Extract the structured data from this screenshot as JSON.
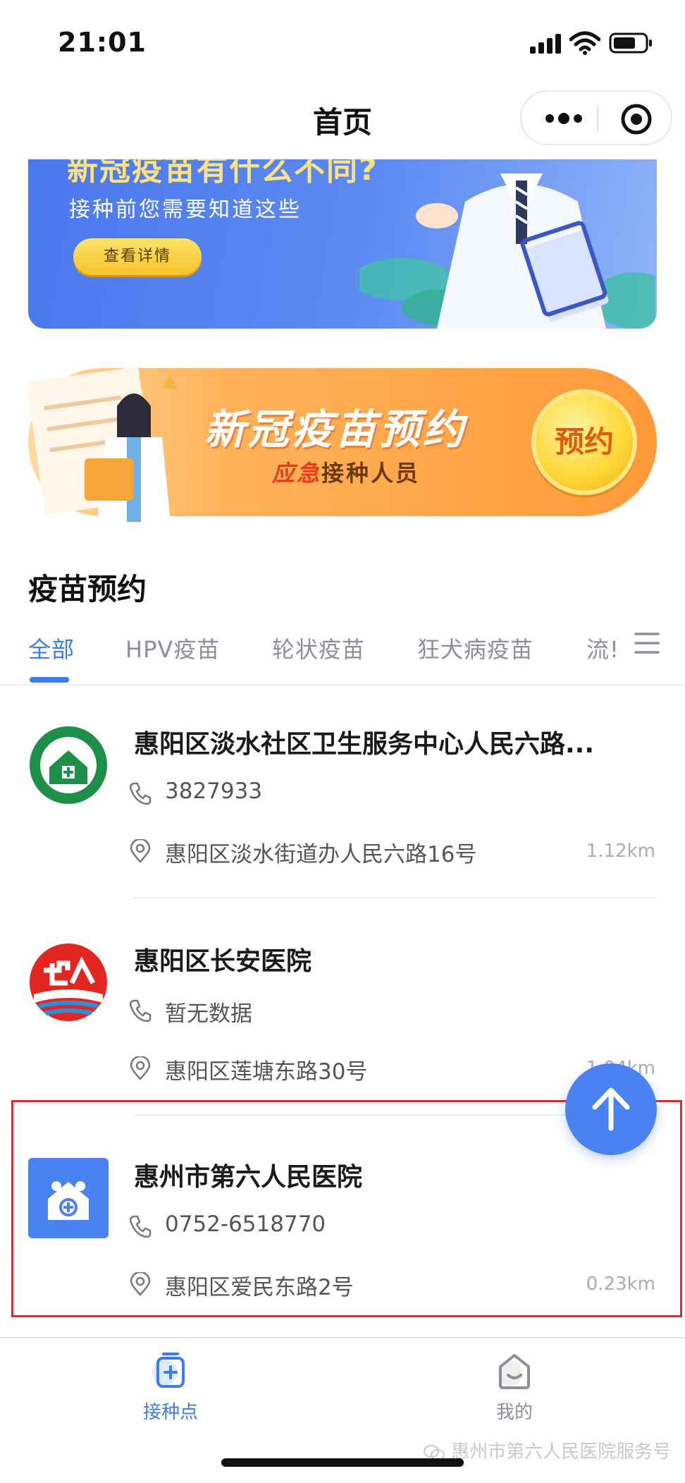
{
  "status_bar": {
    "time": "21:01"
  },
  "nav": {
    "title": "首页"
  },
  "banner_top": {
    "cut_title": "新冠疫苗有什么不同?",
    "subtitle": "接种前您需要知道这些",
    "button": "查看详情"
  },
  "banner_main": {
    "title": "新冠疫苗预约",
    "subtitle_highlight": "应急",
    "subtitle_rest": "接种人员",
    "badge": "预约"
  },
  "section": {
    "title": "疫苗预约",
    "tabs": [
      {
        "label": "全部"
      },
      {
        "label": "HPV疫苗"
      },
      {
        "label": "轮状疫苗"
      },
      {
        "label": "狂犬病疫苗"
      },
      {
        "label": "流!"
      }
    ]
  },
  "hospitals": [
    {
      "name": "惠阳区淡水社区卫生服务中心人民六路...",
      "phone": "3827933",
      "address": "惠阳区淡水街道办人民六路16号",
      "distance": "1.12km"
    },
    {
      "name": "惠阳区长安医院",
      "phone": "暂无数据",
      "address": "惠阳区莲塘东路30号",
      "distance": "1.04km"
    },
    {
      "name": "惠州市第六人民医院",
      "phone": "0752-6518770",
      "address": "惠阳区爱民东路2号",
      "distance": "0.23km"
    }
  ],
  "tabbar": {
    "items": [
      {
        "label": "接种点"
      },
      {
        "label": "我的"
      }
    ]
  },
  "watermark": "惠州市第六人民医院服务号",
  "colors": {
    "accent": "#3a7bf0",
    "highlight_border": "#e02828",
    "orange": "#ff9a3a"
  },
  "icons": [
    "signal-icon",
    "wifi-icon",
    "battery-icon",
    "more-icon",
    "target-icon",
    "menu-icon",
    "phone-icon",
    "location-icon",
    "arrow-up-icon",
    "vaccination-point-icon",
    "profile-icon",
    "wechat-icon"
  ]
}
